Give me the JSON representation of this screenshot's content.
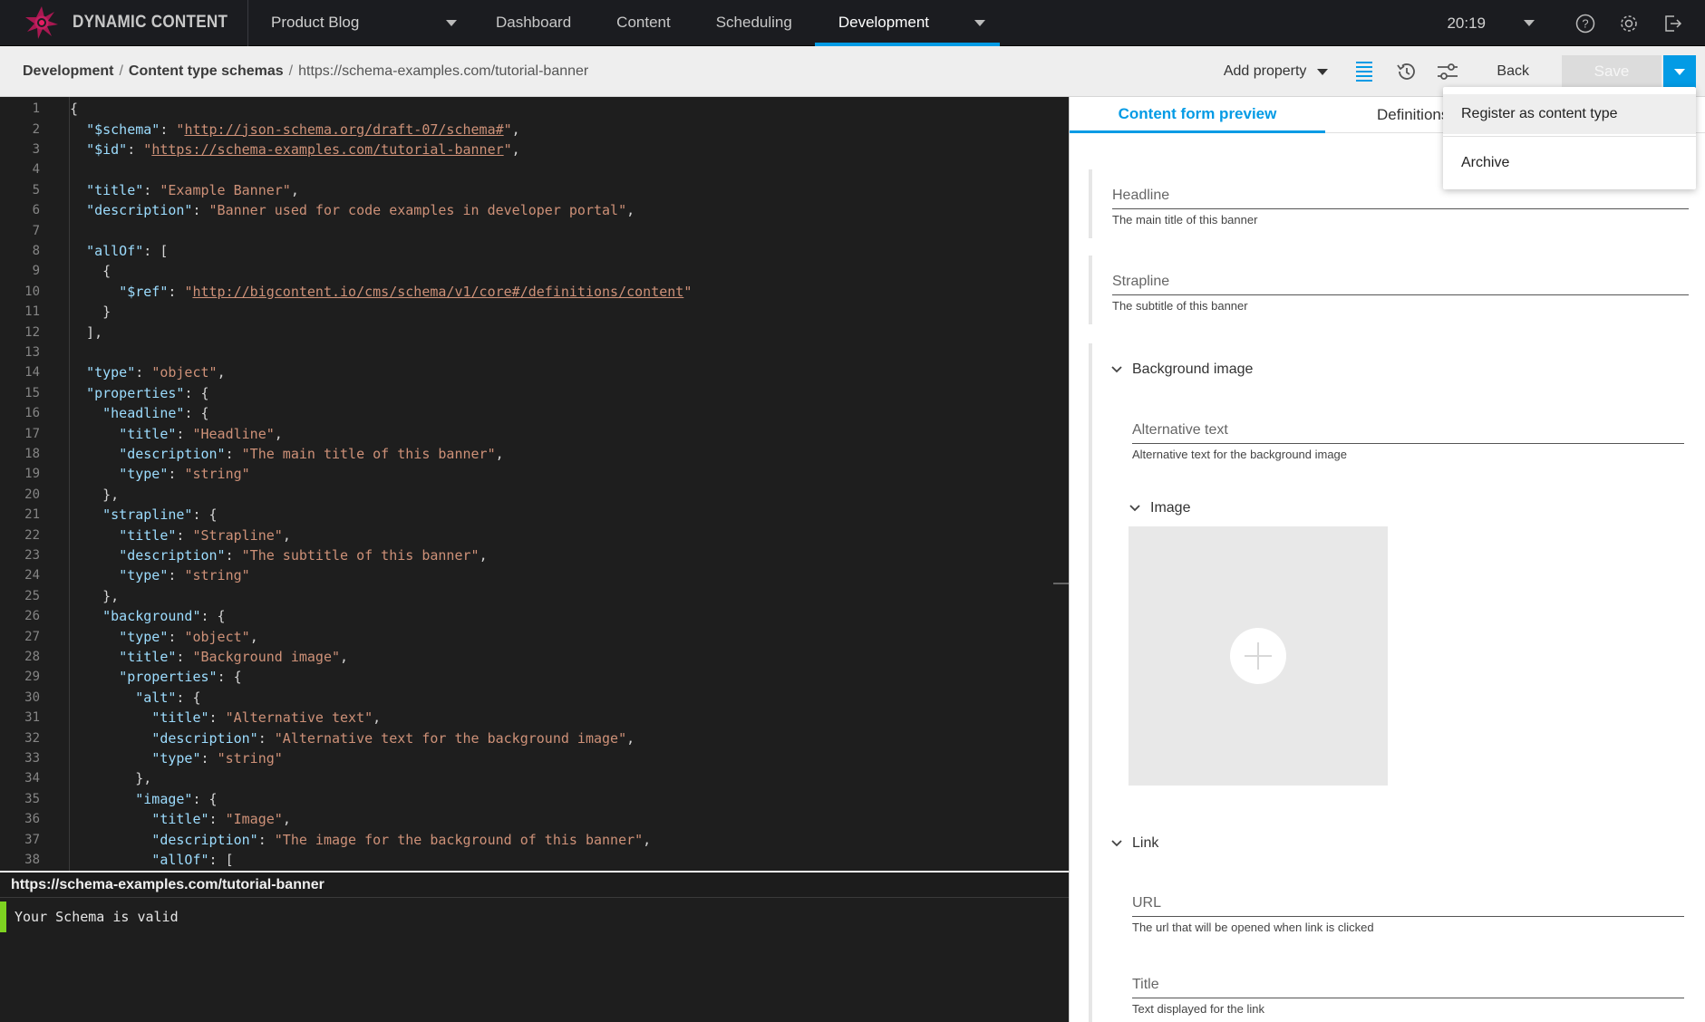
{
  "nav": {
    "brand": "DYNAMIC CONTENT",
    "hub": "Product Blog",
    "tabs": [
      "Dashboard",
      "Content",
      "Scheduling",
      "Development"
    ],
    "clock": "20:19"
  },
  "toolbar": {
    "breadcrumb": {
      "root": "Development",
      "section": "Content type schemas",
      "current": "https://schema-examples.com/tutorial-banner"
    },
    "add_property": "Add property",
    "back": "Back",
    "save": "Save"
  },
  "menu": {
    "items": [
      "Register as content type",
      "Archive"
    ]
  },
  "editor": {
    "lines": [
      "{",
      "  \"$schema\": \"http://json-schema.org/draft-07/schema#\",",
      "  \"$id\": \"https://schema-examples.com/tutorial-banner\",",
      "",
      "  \"title\": \"Example Banner\",",
      "  \"description\": \"Banner used for code examples in developer portal\",",
      "",
      "  \"allOf\": [",
      "    {",
      "      \"$ref\": \"http://bigcontent.io/cms/schema/v1/core#/definitions/content\"",
      "    }",
      "  ],",
      "",
      "  \"type\": \"object\",",
      "  \"properties\": {",
      "    \"headline\": {",
      "      \"title\": \"Headline\",",
      "      \"description\": \"The main title of this banner\",",
      "      \"type\": \"string\"",
      "    },",
      "    \"strapline\": {",
      "      \"title\": \"Strapline\",",
      "      \"description\": \"The subtitle of this banner\",",
      "      \"type\": \"string\"",
      "    },",
      "    \"background\": {",
      "      \"type\": \"object\",",
      "      \"title\": \"Background image\",",
      "      \"properties\": {",
      "        \"alt\": {",
      "          \"title\": \"Alternative text\",",
      "          \"description\": \"Alternative text for the background image\",",
      "          \"type\": \"string\"",
      "        },",
      "        \"image\": {",
      "          \"title\": \"Image\",",
      "          \"description\": \"The image for the background of this banner\",",
      "          \"allOf\": ["
    ]
  },
  "status": {
    "schema_id": "https://schema-examples.com/tutorial-banner",
    "message": "Your Schema is valid"
  },
  "preview": {
    "tabs": [
      "Content form preview",
      "Definitions"
    ],
    "headline": {
      "label": "Headline",
      "desc": "The main title of this banner"
    },
    "strapline": {
      "label": "Strapline",
      "desc": "The subtitle of this banner"
    },
    "background": {
      "title": "Background image",
      "alt": {
        "label": "Alternative text",
        "desc": "Alternative text for the background image"
      },
      "image_title": "Image"
    },
    "link": {
      "title": "Link",
      "url": {
        "label": "URL",
        "desc": "The url that will be opened when link is clicked"
      },
      "title_field": {
        "label": "Title",
        "desc": "Text displayed for the link"
      }
    }
  },
  "colors": {
    "accent": "#039be5",
    "valid": "#7ed321",
    "nav_bg": "#1b1c20",
    "editor_bg": "#1e1e1e"
  }
}
